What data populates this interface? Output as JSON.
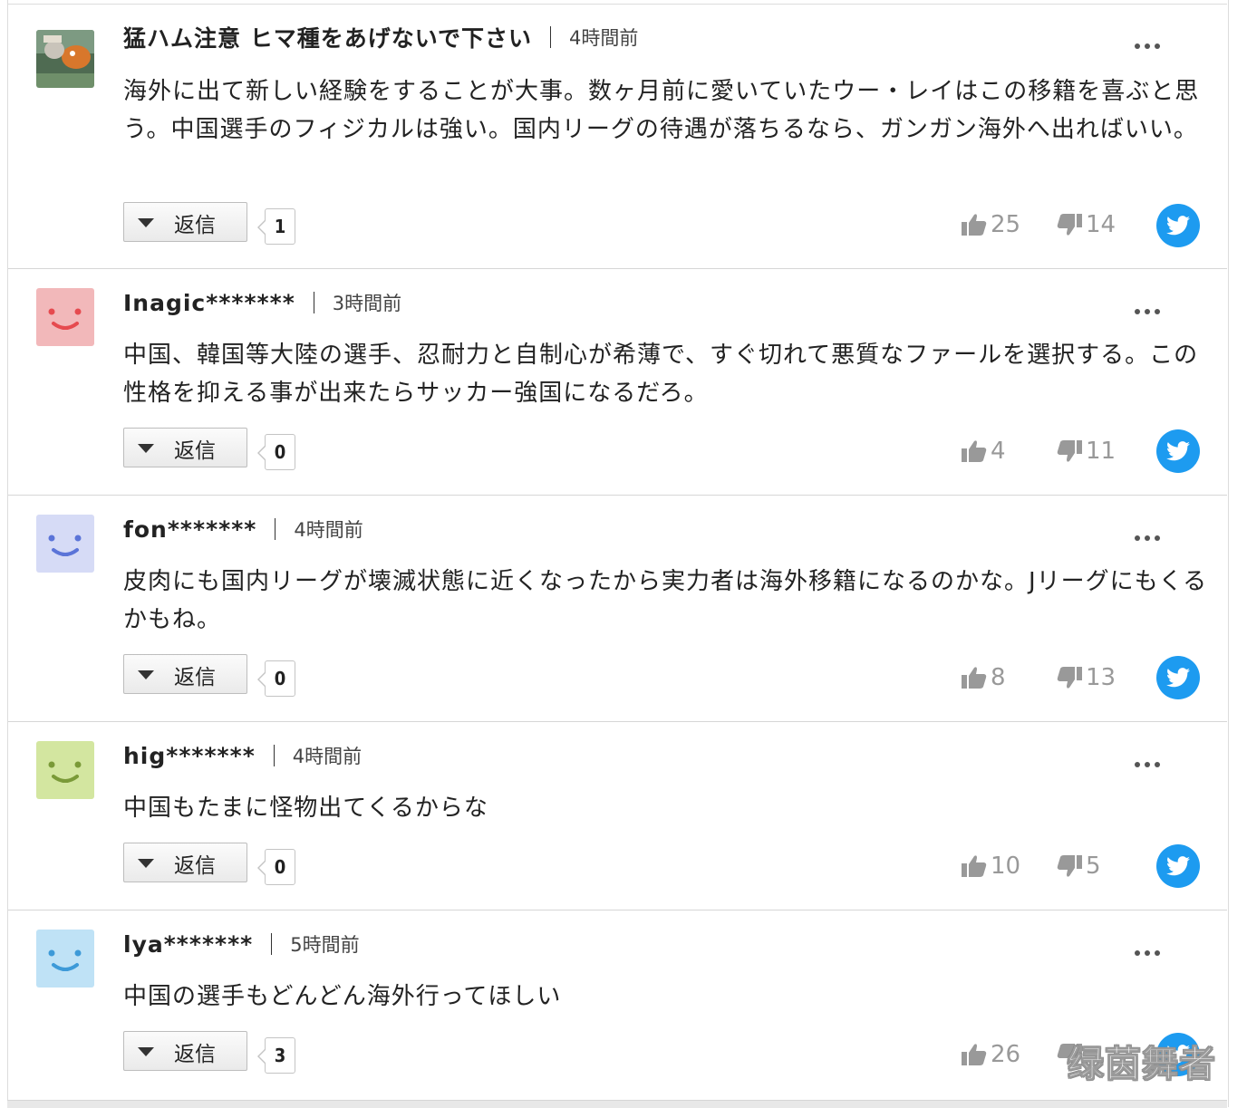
{
  "comments": [
    {
      "user": "猛ハム注意 ヒマ種をあげないで下さい",
      "time": "4時間前",
      "text": "海外に出て新しい経験をすることが大事。数ヶ月前に愛いていたウー・レイはこの移籍を喜ぶと思う。中国選手のフィジカルは強い。国内リーグの待遇が落ちるなら、ガンガン海外へ出ればいい。",
      "reply_label": "返信",
      "reply_count": "1",
      "likes": "25",
      "dislikes": "14",
      "avatar": "photo-avatar"
    },
    {
      "user": "Inagic*******",
      "time": "3時間前",
      "text": "中国、韓国等大陸の選手、忍耐力と自制心が希薄で、すぐ切れて悪質なファールを選択する。この性格を抑える事が出来たらサッカー強国になるだろ。",
      "reply_label": "返信",
      "reply_count": "0",
      "likes": "4",
      "dislikes": "11",
      "avatar": "smiley-pink",
      "avatar_color": "#f2b8ba"
    },
    {
      "user": "fon*******",
      "time": "4時間前",
      "text": "皮肉にも国内リーグが壊滅状態に近くなったから実力者は海外移籍になるのかな。Jリーグにもくるかもね。",
      "reply_label": "返信",
      "reply_count": "0",
      "likes": "8",
      "dislikes": "13",
      "avatar": "smiley-lavender",
      "avatar_color": "#d6dbf6"
    },
    {
      "user": "hig*******",
      "time": "4時間前",
      "text": "中国もたまに怪物出てくるからな",
      "reply_label": "返信",
      "reply_count": "0",
      "likes": "10",
      "dislikes": "5",
      "avatar": "smiley-lime",
      "avatar_color": "#d3e6a0"
    },
    {
      "user": "lya*******",
      "time": "5時間前",
      "text": "中国の選手もどんどん海外行ってほしい",
      "reply_label": "返信",
      "reply_count": "3",
      "likes": "26",
      "dislikes": "",
      "avatar": "smiley-skyblue",
      "avatar_color": "#bfe2f6"
    }
  ],
  "watermark": "绿茵舞者",
  "colors": {
    "twitter": "#1d9bf0",
    "vote_gray": "#999999"
  }
}
